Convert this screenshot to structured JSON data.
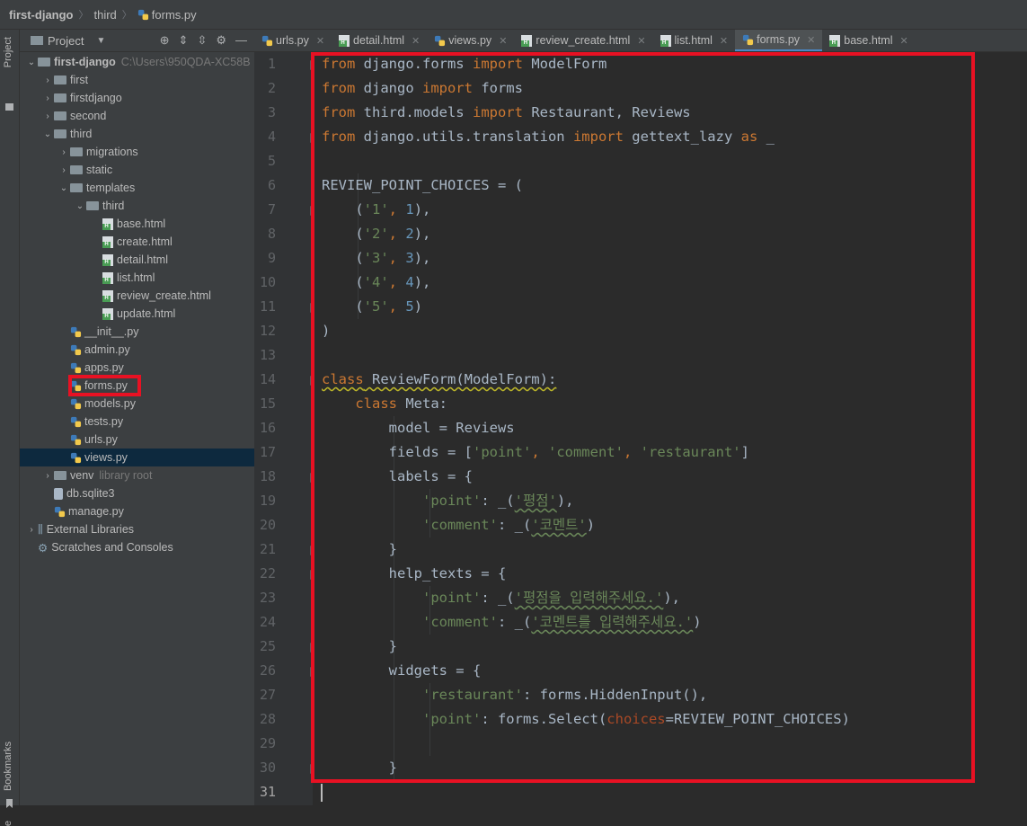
{
  "breadcrumb": {
    "project": "first-django",
    "folder": "third",
    "file": "forms.py"
  },
  "stripe": {
    "project_label": "Project",
    "bookmarks_label": "Bookmarks",
    "bottom_label": "e"
  },
  "panel": {
    "title": "Project"
  },
  "tree": [
    {
      "label": "first-django",
      "suffix": "C:\\Users\\950QDA-XC58B",
      "indent": 0,
      "arrow": "open",
      "icon": "folder",
      "bold": true
    },
    {
      "label": "first",
      "indent": 1,
      "arrow": "closed",
      "icon": "folder"
    },
    {
      "label": "firstdjango",
      "indent": 1,
      "arrow": "closed",
      "icon": "folder"
    },
    {
      "label": "second",
      "indent": 1,
      "arrow": "closed",
      "icon": "folder"
    },
    {
      "label": "third",
      "indent": 1,
      "arrow": "open",
      "icon": "folder"
    },
    {
      "label": "migrations",
      "indent": 2,
      "arrow": "closed",
      "icon": "folder"
    },
    {
      "label": "static",
      "indent": 2,
      "arrow": "closed",
      "icon": "folder"
    },
    {
      "label": "templates",
      "indent": 2,
      "arrow": "open",
      "icon": "folder"
    },
    {
      "label": "third",
      "indent": 3,
      "arrow": "open",
      "icon": "folder"
    },
    {
      "label": "base.html",
      "indent": 4,
      "arrow": "none",
      "icon": "html"
    },
    {
      "label": "create.html",
      "indent": 4,
      "arrow": "none",
      "icon": "html"
    },
    {
      "label": "detail.html",
      "indent": 4,
      "arrow": "none",
      "icon": "html"
    },
    {
      "label": "list.html",
      "indent": 4,
      "arrow": "none",
      "icon": "html"
    },
    {
      "label": "review_create.html",
      "indent": 4,
      "arrow": "none",
      "icon": "html"
    },
    {
      "label": "update.html",
      "indent": 4,
      "arrow": "none",
      "icon": "html"
    },
    {
      "label": "__init__.py",
      "indent": 2,
      "arrow": "none",
      "icon": "py"
    },
    {
      "label": "admin.py",
      "indent": 2,
      "arrow": "none",
      "icon": "py"
    },
    {
      "label": "apps.py",
      "indent": 2,
      "arrow": "none",
      "icon": "py"
    },
    {
      "label": "forms.py",
      "indent": 2,
      "arrow": "none",
      "icon": "py",
      "highlight": true
    },
    {
      "label": "models.py",
      "indent": 2,
      "arrow": "none",
      "icon": "py"
    },
    {
      "label": "tests.py",
      "indent": 2,
      "arrow": "none",
      "icon": "py"
    },
    {
      "label": "urls.py",
      "indent": 2,
      "arrow": "none",
      "icon": "py"
    },
    {
      "label": "views.py",
      "indent": 2,
      "arrow": "none",
      "icon": "py",
      "selected": true
    },
    {
      "label": "venv",
      "suffix": "library root",
      "indent": 1,
      "arrow": "closed",
      "icon": "folder"
    },
    {
      "label": "db.sqlite3",
      "indent": 1,
      "arrow": "none",
      "icon": "db"
    },
    {
      "label": "manage.py",
      "indent": 1,
      "arrow": "none",
      "icon": "py"
    },
    {
      "label": "External Libraries",
      "indent": 0,
      "arrow": "closed",
      "icon": "lib"
    },
    {
      "label": "Scratches and Consoles",
      "indent": 0,
      "arrow": "none",
      "icon": "scratch"
    }
  ],
  "tabs": [
    {
      "label": "urls.py",
      "icon": "py"
    },
    {
      "label": "detail.html",
      "icon": "html"
    },
    {
      "label": "views.py",
      "icon": "py"
    },
    {
      "label": "review_create.html",
      "icon": "html"
    },
    {
      "label": "list.html",
      "icon": "html"
    },
    {
      "label": "forms.py",
      "icon": "py",
      "active": true
    },
    {
      "label": "base.html",
      "icon": "html"
    }
  ],
  "code": [
    [
      [
        "k",
        "from"
      ],
      [
        "t",
        " django.forms "
      ],
      [
        "k",
        "import"
      ],
      [
        "t",
        " ModelForm"
      ]
    ],
    [
      [
        "k",
        "from"
      ],
      [
        "t",
        " django "
      ],
      [
        "k",
        "import"
      ],
      [
        "t",
        " forms"
      ]
    ],
    [
      [
        "k",
        "from"
      ],
      [
        "t",
        " third.models "
      ],
      [
        "k",
        "import"
      ],
      [
        "t",
        " Restaurant, Reviews"
      ]
    ],
    [
      [
        "k",
        "from"
      ],
      [
        "t",
        " django.utils.translation "
      ],
      [
        "k",
        "import"
      ],
      [
        "t",
        " gettext_lazy "
      ],
      [
        "k",
        "as"
      ],
      [
        "t",
        " _"
      ]
    ],
    [],
    [
      [
        "t",
        "REVIEW_POINT_CHOICES = ("
      ]
    ],
    [
      [
        "t",
        "    ("
      ],
      [
        "s",
        "'1'"
      ],
      [
        "k",
        ", "
      ],
      [
        "n",
        "1"
      ],
      [
        "t",
        "),"
      ]
    ],
    [
      [
        "t",
        "    ("
      ],
      [
        "s",
        "'2'"
      ],
      [
        "k",
        ", "
      ],
      [
        "n",
        "2"
      ],
      [
        "t",
        "),"
      ]
    ],
    [
      [
        "t",
        "    ("
      ],
      [
        "s",
        "'3'"
      ],
      [
        "k",
        ", "
      ],
      [
        "n",
        "3"
      ],
      [
        "t",
        "),"
      ]
    ],
    [
      [
        "t",
        "    ("
      ],
      [
        "s",
        "'4'"
      ],
      [
        "k",
        ", "
      ],
      [
        "n",
        "4"
      ],
      [
        "t",
        "),"
      ]
    ],
    [
      [
        "t",
        "    ("
      ],
      [
        "s",
        "'5'"
      ],
      [
        "k",
        ", "
      ],
      [
        "n",
        "5"
      ],
      [
        "t",
        ")"
      ]
    ],
    [
      [
        "t",
        ")"
      ]
    ],
    [],
    [
      [
        "k",
        "class"
      ],
      [
        "t",
        " ReviewForm(ModelForm):"
      ]
    ],
    [
      [
        "t",
        "    "
      ],
      [
        "k",
        "class"
      ],
      [
        "t",
        " Meta:"
      ]
    ],
    [
      [
        "t",
        "        model = Reviews"
      ]
    ],
    [
      [
        "t",
        "        fields = ["
      ],
      [
        "s",
        "'point'"
      ],
      [
        "k",
        ", "
      ],
      [
        "s",
        "'comment'"
      ],
      [
        "k",
        ", "
      ],
      [
        "s",
        "'restaurant'"
      ],
      [
        "t",
        "]"
      ]
    ],
    [
      [
        "t",
        "        labels = {"
      ]
    ],
    [
      [
        "t",
        "            "
      ],
      [
        "s",
        "'point'"
      ],
      [
        "t",
        ": _("
      ],
      [
        "s",
        "'평점'"
      ],
      [
        "t",
        "),"
      ]
    ],
    [
      [
        "t",
        "            "
      ],
      [
        "s",
        "'comment'"
      ],
      [
        "t",
        ": _("
      ],
      [
        "s",
        "'코멘트'"
      ],
      [
        "t",
        ")"
      ]
    ],
    [
      [
        "t",
        "        }"
      ]
    ],
    [
      [
        "t",
        "        help_texts = {"
      ]
    ],
    [
      [
        "t",
        "            "
      ],
      [
        "s",
        "'point'"
      ],
      [
        "t",
        ": _("
      ],
      [
        "s",
        "'평점을 입력해주세요.'"
      ],
      [
        "t",
        "),"
      ]
    ],
    [
      [
        "t",
        "            "
      ],
      [
        "s",
        "'comment'"
      ],
      [
        "t",
        ": _("
      ],
      [
        "s",
        "'코멘트를 입력해주세요.'"
      ],
      [
        "t",
        ")"
      ]
    ],
    [
      [
        "t",
        "        }"
      ]
    ],
    [
      [
        "t",
        "        widgets = {"
      ]
    ],
    [
      [
        "t",
        "            "
      ],
      [
        "s",
        "'restaurant'"
      ],
      [
        "t",
        ": forms.HiddenInput(),"
      ]
    ],
    [
      [
        "t",
        "            "
      ],
      [
        "s",
        "'point'"
      ],
      [
        "t",
        ": forms.Select("
      ],
      [
        "p",
        "choices"
      ],
      [
        "t",
        "=REVIEW_POINT_CHOICES)"
      ]
    ],
    [],
    [
      [
        "t",
        "        }"
      ]
    ],
    []
  ]
}
